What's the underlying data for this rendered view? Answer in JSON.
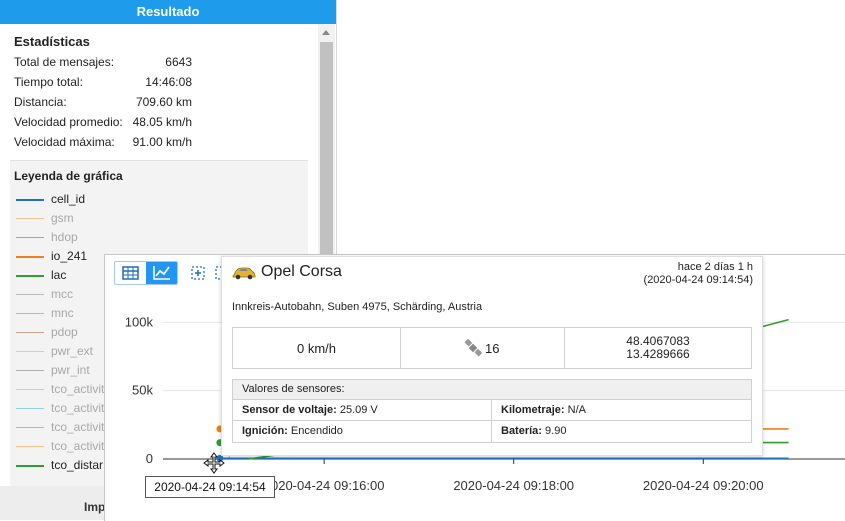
{
  "panel": {
    "header": "Resultado",
    "stats_title": "Estadísticas",
    "stats": [
      {
        "label": "Total de mensajes:",
        "value": "6643"
      },
      {
        "label": "Tiempo total:",
        "value": "14:46:08"
      },
      {
        "label": "Distancia:",
        "value": "709.60 km"
      },
      {
        "label": "Velocidad promedio:",
        "value": "48.05 km/h"
      },
      {
        "label": "Velocidad máxima:",
        "value": "91.00 km/h"
      }
    ],
    "legend_title": "Leyenda de gráfica",
    "legend": [
      {
        "label": "cell_id",
        "color": "#1f6fc5",
        "active": true
      },
      {
        "label": "gsm",
        "color": "#f5c08a",
        "active": false
      },
      {
        "label": "hdop",
        "color": "#a3a3a3",
        "active": false
      },
      {
        "label": "io_241",
        "color": "#f07f1a",
        "active": true
      },
      {
        "label": "lac",
        "color": "#2f9e2f",
        "active": true
      },
      {
        "label": "mcc",
        "color": "#b9b9b9",
        "active": false
      },
      {
        "label": "mnc",
        "color": "#c9a6e0",
        "active": false
      },
      {
        "label": "pdop",
        "color": "#c9a090",
        "active": false
      },
      {
        "label": "pwr_ext",
        "color": "#f4b8d8",
        "active": false
      },
      {
        "label": "pwr_int",
        "color": "#b0b0b0",
        "active": false
      },
      {
        "label": "tco_activit",
        "color": "#d8d87a",
        "active": false
      },
      {
        "label": "tco_activit",
        "color": "#8fd0e8",
        "active": false
      },
      {
        "label": "tco_activit",
        "color": "#9bb8e8",
        "active": false
      },
      {
        "label": "tco_activit",
        "color": "#f5c08a",
        "active": false
      },
      {
        "label": "tco_distar",
        "color": "#2f9e2f",
        "active": true
      }
    ],
    "bottom_label": "Imp"
  },
  "chart_data": {
    "type": "line",
    "y_ticks": [
      "100k",
      "50k",
      "0"
    ],
    "y_tick_values": [
      100000,
      50000,
      0
    ],
    "ylim": [
      0,
      120000
    ],
    "x_ticks": [
      "2020-04-24 09:16:00",
      "2020-04-24 09:18:00",
      "2020-04-24 09:20:00"
    ],
    "x_tick_minutes": [
      16,
      18,
      20
    ],
    "xlim_minutes": [
      14.3,
      21.2
    ],
    "series": [
      {
        "name": "io_241",
        "color": "#f07f1a",
        "points": [
          [
            14.9,
            22000
          ],
          [
            20.9,
            22000
          ]
        ]
      },
      {
        "name": "lac",
        "color": "#2f9e2f",
        "points": [
          [
            14.9,
            12000
          ],
          [
            20.9,
            12000
          ]
        ]
      },
      {
        "name": "cell_id",
        "color": "#1f6fc5",
        "points": [
          [
            14.9,
            500
          ],
          [
            20.9,
            500
          ]
        ]
      },
      {
        "name": "tco_distar",
        "color": "#2f9e2f",
        "points": [
          [
            15.2,
            0
          ],
          [
            15.6,
            4000
          ],
          [
            20.9,
            102000
          ]
        ]
      }
    ],
    "markers": [
      {
        "series": "io_241",
        "x": 14.9,
        "y": 22000
      },
      {
        "series": "lac",
        "x": 14.9,
        "y": 12000
      },
      {
        "series": "cell_id",
        "x": 14.9,
        "y": 500
      }
    ],
    "crosshair_x": 15.0,
    "grid": true
  },
  "popup": {
    "vehicle": "Opel Corsa",
    "time_ago": "hace 2 días 1 h",
    "time_exact": "(2020-04-24 09:14:54)",
    "address": "Innkreis-Autobahn, Suben 4975, Schärding, Austria",
    "speed": "0 km/h",
    "satellites": "16",
    "latitude": "48.4067083",
    "longitude": "13.4289666",
    "sensors_header": "Valores de sensores:",
    "sensors": [
      {
        "label": "Sensor de voltaje:",
        "value": "25.09 V"
      },
      {
        "label": "Kilometraje:",
        "value": "N/A"
      },
      {
        "label": "Ignición:",
        "value": "Encendido"
      },
      {
        "label": "Batería:",
        "value": "9.90"
      }
    ]
  },
  "tooltip": {
    "time": "2020-04-24 09:14:54"
  },
  "colors": {
    "accent": "#1e9bea",
    "button_active": "#2196f3"
  }
}
